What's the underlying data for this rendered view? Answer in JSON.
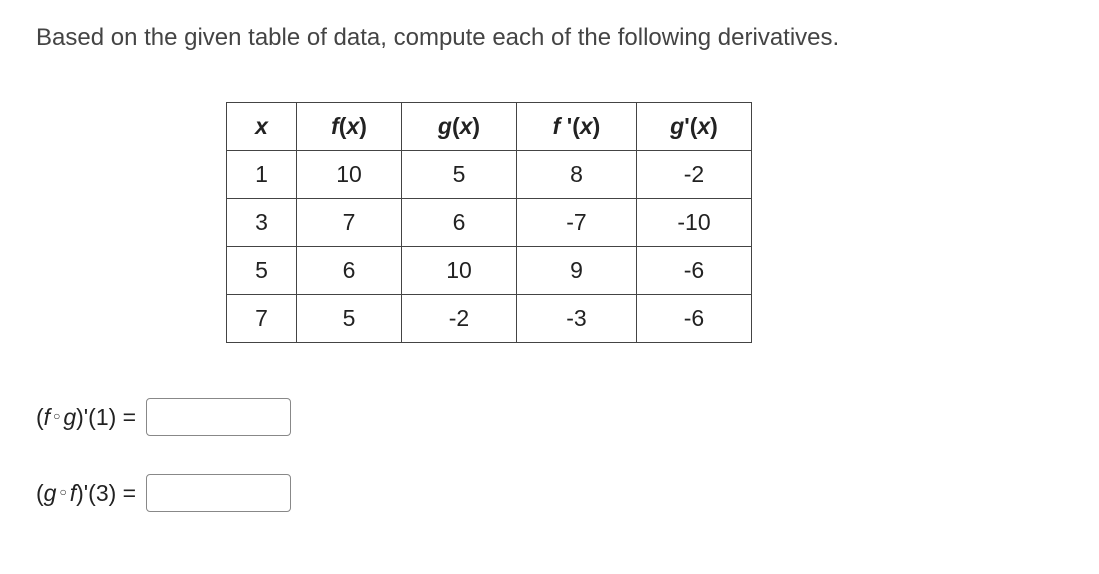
{
  "prompt": "Based on the given table of data, compute each of the following derivatives.",
  "chart_data": {
    "type": "table",
    "headers": {
      "x": "x",
      "fx": "f(x)",
      "gx": "g(x)",
      "fpx": "f '(x)",
      "gpx": "g'(x)"
    },
    "rows": [
      {
        "x": "1",
        "fx": "10",
        "gx": "5",
        "fpx": "8",
        "gpx": "-2"
      },
      {
        "x": "3",
        "fx": "7",
        "gx": "6",
        "fpx": "-7",
        "gpx": "-10"
      },
      {
        "x": "5",
        "fx": "6",
        "gx": "10",
        "fpx": "9",
        "gpx": "-6"
      },
      {
        "x": "7",
        "fx": "5",
        "gx": "-2",
        "fpx": "-3",
        "gpx": "-6"
      }
    ]
  },
  "questions": {
    "q1": {
      "label_html": "(f ∘ g)'(1) =",
      "value": ""
    },
    "q2": {
      "label_html": "(g ∘ f)'(3) =",
      "value": ""
    }
  }
}
